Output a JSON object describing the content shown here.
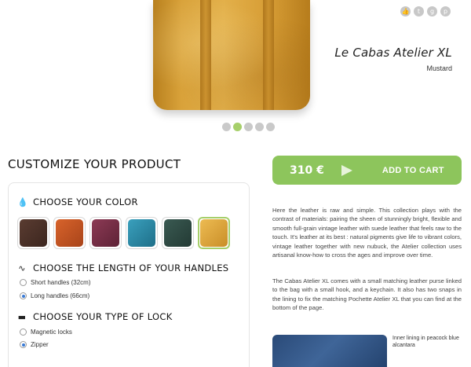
{
  "product": {
    "name": "Le Cabas Atelier XL",
    "color_name": "Mustard"
  },
  "social": {
    "icons": [
      "like-icon",
      "twitter-icon",
      "google-plus-icon",
      "pinterest-icon"
    ],
    "glyphs": [
      "👍",
      "t",
      "g",
      "p"
    ]
  },
  "carousel": {
    "count": 5,
    "active_index": 1
  },
  "customize": {
    "title": "CUSTOMIZE YOUR PRODUCT",
    "color_section": {
      "title": "CHOOSE YOUR COLOR",
      "swatches": [
        {
          "name": "brown",
          "color": "#4a3128"
        },
        {
          "name": "orange",
          "color": "#c4521f"
        },
        {
          "name": "plum",
          "color": "#7a3047"
        },
        {
          "name": "peacock-blue",
          "color": "#2a8aa6"
        },
        {
          "name": "dark-green",
          "color": "#2e4a43"
        },
        {
          "name": "mustard",
          "color": "#e0a93e"
        }
      ],
      "selected_index": 5
    },
    "handles_section": {
      "title": "CHOOSE THE LENGTH OF YOUR HANDLES",
      "options": [
        "Short handles (32cm)",
        "Long handles (66cm)"
      ],
      "selected_index": 1
    },
    "lock_section": {
      "title": "CHOOSE YOUR TYPE OF LOCK",
      "options": [
        "Magnetic locks",
        "Zipper"
      ],
      "selected_index": 1
    }
  },
  "cart": {
    "price": "310 €",
    "label": "ADD TO CART",
    "color": "#8dc55c"
  },
  "description": {
    "paragraph1": "Here the leather is raw and simple. This collection plays with the contrast of materials: pairing the sheen of stunningly bright, flexible and smooth full-grain vintage leather with suede leather that feels raw to the touch. It's leather at its best : natural pigments give life to vibrant colors, vintage leather together with new nubuck, the Atelier collection uses artisanal know-how to cross the ages and improve over time.",
    "paragraph2": "The Cabas Atelier XL comes with a small matching leather purse linked to the bag with a small hook, and a keychain. It also has two snaps in the lining to fix the matching Pochette Atelier XL that you can find at the bottom of the page."
  },
  "lining": {
    "caption": "Inner lining in peacock blue alcantara"
  }
}
